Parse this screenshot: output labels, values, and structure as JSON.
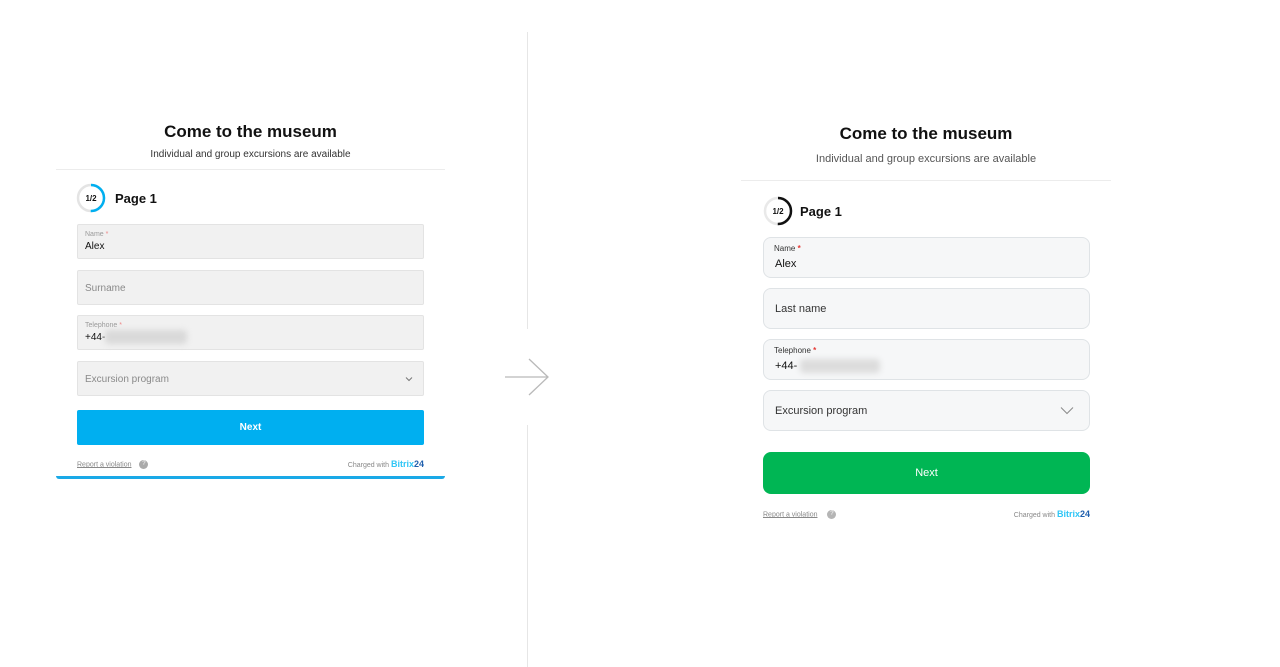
{
  "old_form": {
    "title": "Come to the museum",
    "subtitle": "Individual and group excursions are available",
    "page_indicator": "1/2",
    "page_label": "Page 1",
    "progress_fraction": 0.5,
    "name_label": "Name",
    "name_value": "Alex",
    "surname_placeholder": "Surname",
    "telephone_label": "Telephone",
    "telephone_value": "+44-",
    "excursion_placeholder": "Excursion program",
    "next_label": "Next",
    "report_label": "Report a violation",
    "charged_label": "Charged with",
    "brand_part1": "Bitrix",
    "brand_part2": "24",
    "accent_color": "#00aff0"
  },
  "new_form": {
    "title": "Come to the museum",
    "subtitle": "Individual and group excursions are available",
    "page_indicator": "1/2",
    "page_label": "Page 1",
    "progress_fraction": 0.5,
    "name_label": "Name",
    "name_value": "Alex",
    "surname_placeholder": "Last name",
    "telephone_label": "Telephone",
    "telephone_value": "+44-",
    "excursion_placeholder": "Excursion program",
    "next_label": "Next",
    "report_label": "Report a violation",
    "charged_label": "Charged with",
    "brand_part1": "Bitrix",
    "brand_part2": "24",
    "accent_color": "#00b654"
  },
  "required_mark": "*",
  "help_glyph": "?"
}
